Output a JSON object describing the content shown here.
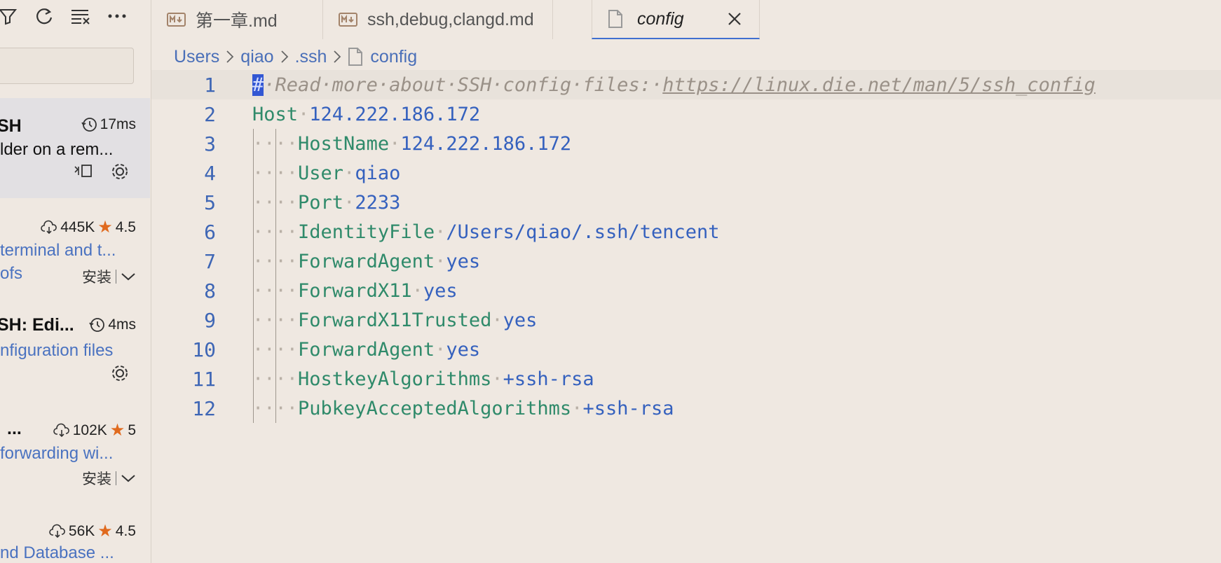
{
  "colors": {
    "background": "#efe8e1",
    "accent": "#3f6fd0",
    "keyword": "#2f8a6a",
    "value": "#3561be",
    "comment": "#9a9188",
    "line_number": "#3e66b5",
    "star": "#e06a1e"
  },
  "sidebar": {
    "toolbar_icons": [
      "filter-icon",
      "refresh-icon",
      "clear-list-icon",
      "more-icon"
    ],
    "extensions": [
      {
        "name": "SH",
        "time": "17ms",
        "description": "lder on a rem...",
        "selected": true
      },
      {
        "downloads": "445K",
        "rating": "4.5",
        "description": "terminal and t...",
        "sub_description": "ofs",
        "install_label": "安装"
      },
      {
        "name": "SH: Edi...",
        "time": "4ms",
        "description": "nfiguration files"
      },
      {
        "name": "...",
        "downloads": "102K",
        "rating": "5",
        "description": "forwarding wi...",
        "install_label": "安装"
      },
      {
        "downloads": "56K",
        "rating": "4.5",
        "description": "nd Database ..."
      }
    ]
  },
  "tabs": [
    {
      "title": "第一章.md",
      "icon": "markdown-icon",
      "active": false
    },
    {
      "title": "ssh,debug,clangd.md",
      "icon": "markdown-icon",
      "active": false
    },
    {
      "title": "config",
      "icon": "file-icon",
      "active": true
    }
  ],
  "breadcrumb": [
    "Users",
    "qiao",
    ".ssh",
    "config"
  ],
  "editor": {
    "lines": [
      {
        "n": "1",
        "comment": "# Read more about SSH config files: ",
        "link": "https://linux.die.net/man/5/ssh_config"
      },
      {
        "n": "2",
        "key": "Host",
        "value": "124.222.186.172",
        "indent": 0
      },
      {
        "n": "3",
        "key": "HostName",
        "value": "124.222.186.172",
        "indent": 1
      },
      {
        "n": "4",
        "key": "User",
        "value": "qiao",
        "indent": 1
      },
      {
        "n": "5",
        "key": "Port",
        "value": "2233",
        "indent": 1
      },
      {
        "n": "6",
        "key": "IdentityFile",
        "value": "/Users/qiao/.ssh/tencent",
        "indent": 1
      },
      {
        "n": "7",
        "key": "ForwardAgent",
        "value": "yes",
        "indent": 1
      },
      {
        "n": "8",
        "key": "ForwardX11",
        "value": "yes",
        "indent": 1
      },
      {
        "n": "9",
        "key": "ForwardX11Trusted",
        "value": "yes",
        "indent": 1
      },
      {
        "n": "10",
        "key": "ForwardAgent",
        "value": "yes",
        "indent": 1
      },
      {
        "n": "11",
        "key": "HostkeyAlgorithms",
        "value": "+ssh-rsa",
        "indent": 1
      },
      {
        "n": "12",
        "key": "PubkeyAcceptedAlgorithms",
        "value": "+ssh-rsa",
        "indent": 1
      }
    ]
  }
}
